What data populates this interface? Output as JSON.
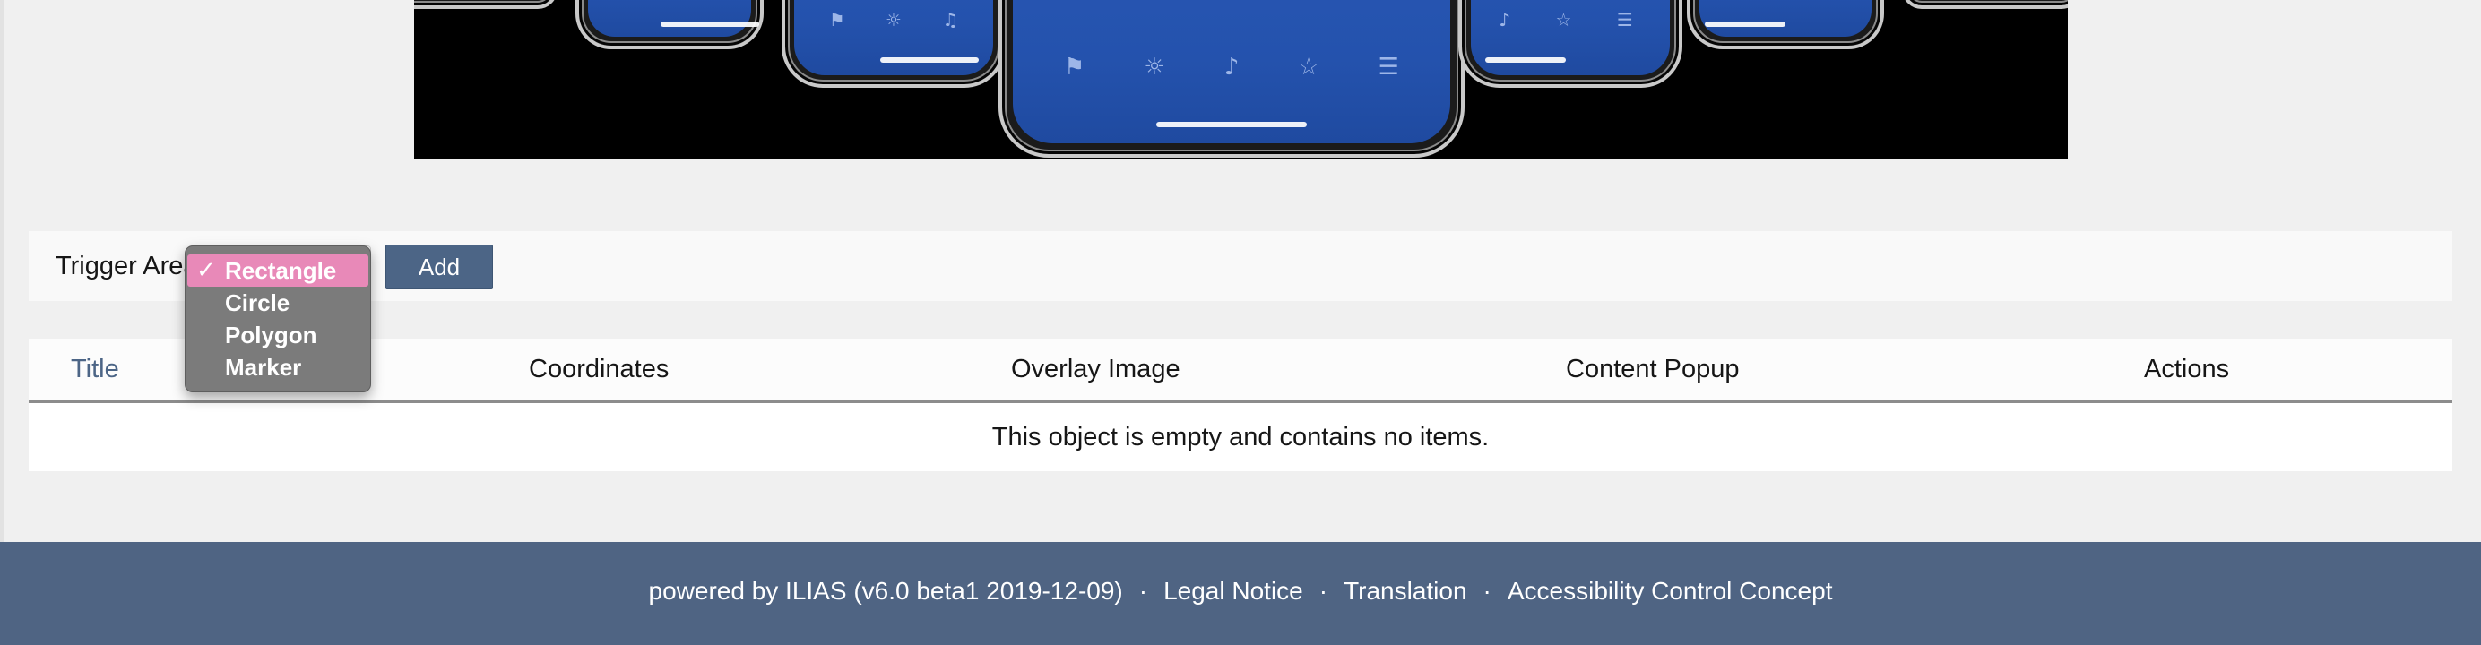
{
  "banner": {
    "icons": [
      "flag-icon",
      "lightbulb-icon",
      "bell-icon",
      "star-icon",
      "menu-icon"
    ]
  },
  "toolbar": {
    "label": "Trigger Area",
    "add_label": "Add",
    "options": [
      "Rectangle",
      "Circle",
      "Polygon",
      "Marker"
    ],
    "selected": "Rectangle",
    "check_glyph": "✓"
  },
  "table": {
    "columns": [
      "Title",
      "Coordinates",
      "Overlay Image",
      "Content Popup",
      "Actions"
    ],
    "empty_message": "This object is empty and contains no items."
  },
  "footer": {
    "powered_by": "powered by ILIAS (v6.0 beta1 2019-12-09)",
    "separator": "·",
    "links": [
      "Legal Notice",
      "Translation",
      "Accessibility Control Concept"
    ]
  },
  "colors": {
    "accent": "#4c6586",
    "footer_bg": "#4f6483",
    "selected_option": "#e889b8",
    "dropdown_bg": "#7b7b7b",
    "phone_screen": "#2a5ab8"
  }
}
